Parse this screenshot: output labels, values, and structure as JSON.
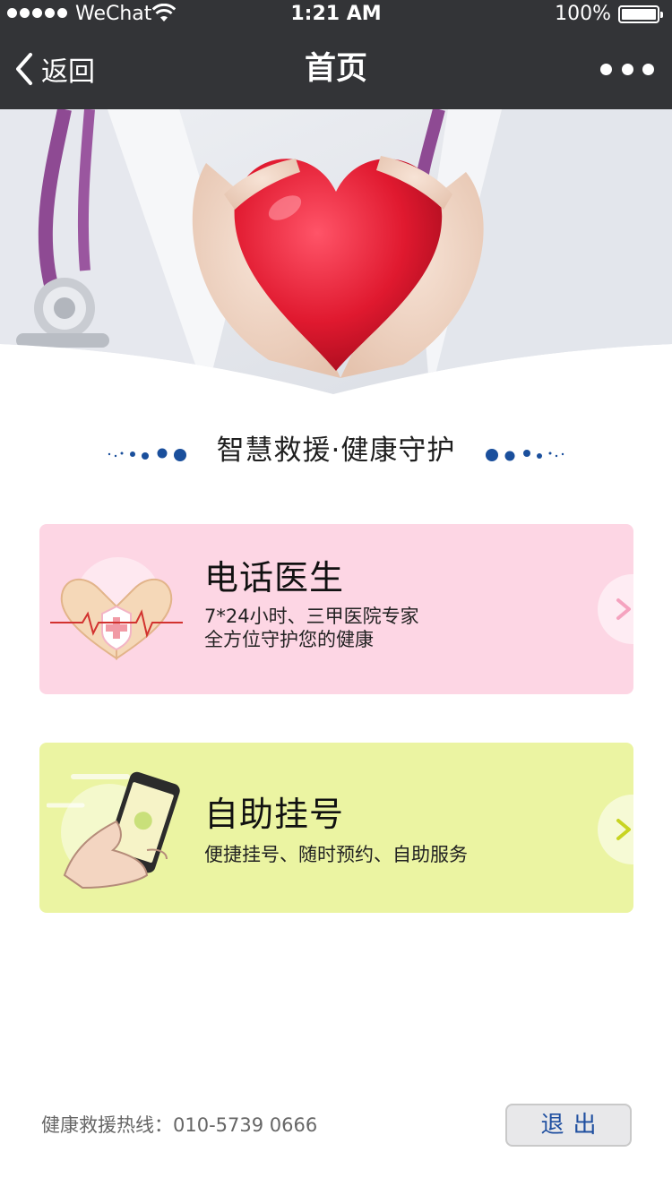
{
  "status_bar": {
    "carrier": "WeChat",
    "time": "1:21 AM",
    "battery": "100%",
    "battery_level": 1.0,
    "signal_icon": "signal-dots-icon",
    "wifi_icon": "wifi-icon"
  },
  "nav": {
    "back_label": "返回",
    "title": "首页",
    "more_icon": "more-dots-icon"
  },
  "slogan": "智慧救援·健康守护",
  "cards": [
    {
      "title": "电话医生",
      "desc_line1": "7*24小时、三甲医院专家",
      "desc_line2": "全方位守护您的健康",
      "color": "#fdd6e4",
      "arrow_color": "#f5a3bf",
      "icon": "heart-hands-icon"
    },
    {
      "title": "自助挂号",
      "desc_line1": "便捷挂号、随时预约、自助服务",
      "color": "#ebf4a2",
      "arrow_color": "#c8d422",
      "icon": "phone-in-hand-icon"
    }
  ],
  "footer": {
    "hotline": "健康救援热线：010-5739 0666",
    "logout_label": "退出"
  },
  "colors": {
    "bar_background": "#333437",
    "accent_blue": "#1a4f9c",
    "logout_text": "#1f4fa0"
  }
}
